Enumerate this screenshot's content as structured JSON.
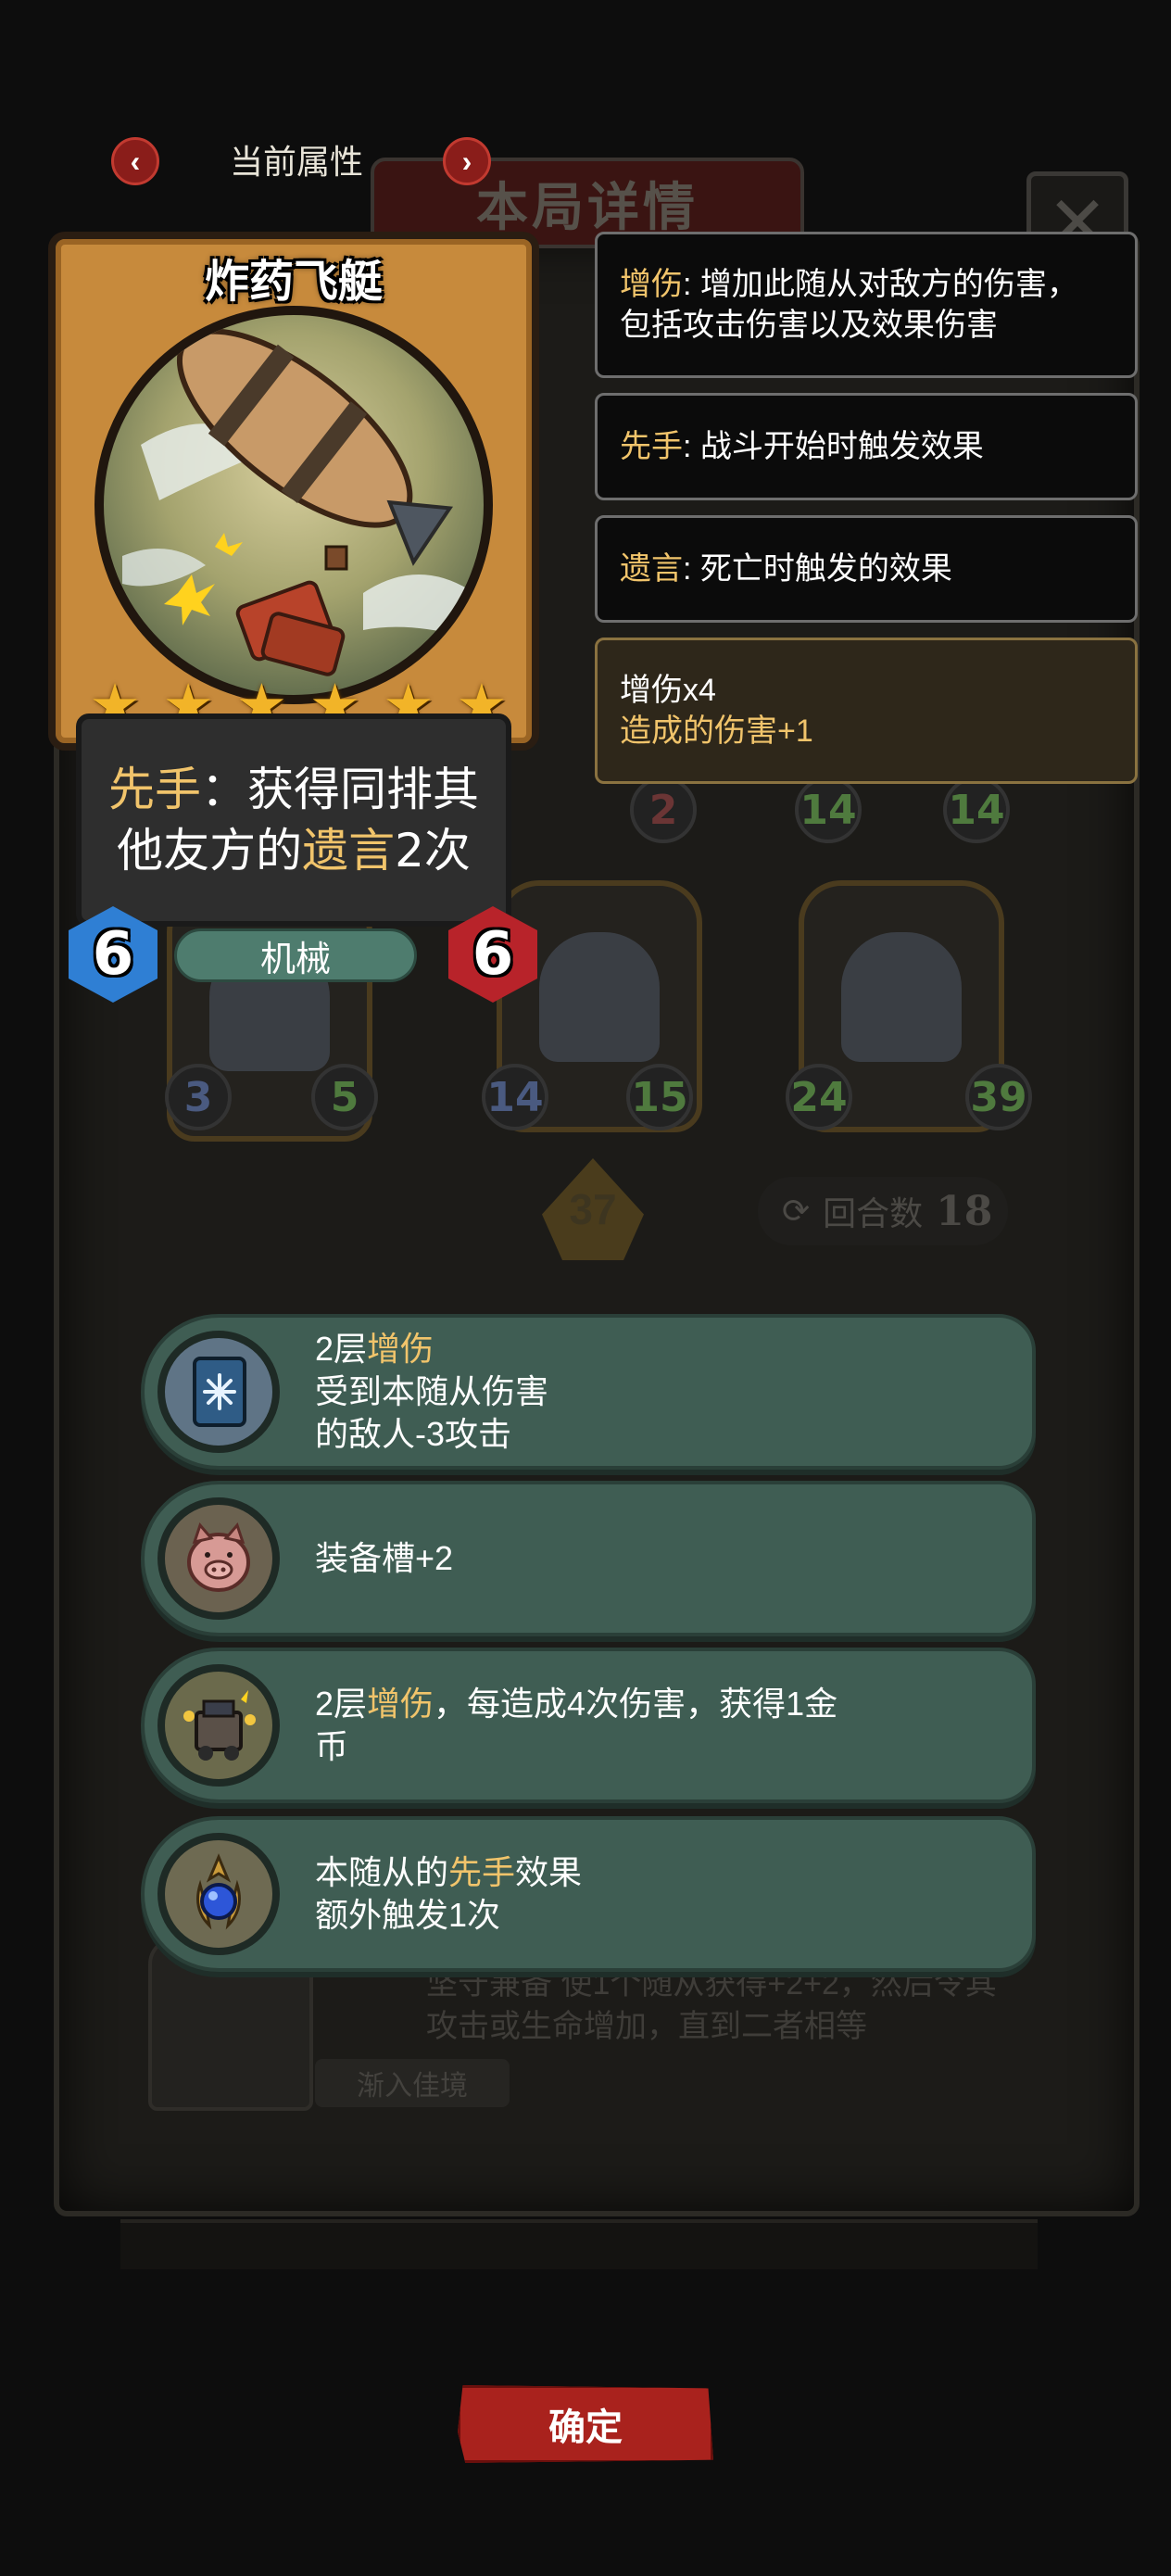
{
  "header": {
    "prev_icon": "chevron-left",
    "next_icon": "chevron-right",
    "title": "当前属性"
  },
  "background": {
    "panel_title": "本局详情",
    "close_icon": "close-x",
    "minions": [
      {
        "attack": "3",
        "health": "5"
      },
      {
        "attack": "14",
        "health": "15"
      },
      {
        "attack": "24",
        "health": "39"
      },
      {
        "attack": "2",
        "health": ""
      },
      {
        "attack": "14",
        "health": "14"
      }
    ],
    "tier": "37",
    "round_label": "回合数",
    "round_value": "18",
    "desc_line1": "坚守兼备 使1个随从获得+2+2，然后令其",
    "desc_line2": "攻击或生命增加，直到二者相等",
    "tag": "渐入佳境"
  },
  "card": {
    "name": "炸药飞艇",
    "stars": 6,
    "text_parts": {
      "kw1": "先手",
      "p1": "：获得同排其他友方的",
      "kw2": "遗言",
      "p2": "2次"
    },
    "attack": "6",
    "health": "6",
    "tribe": "机械",
    "colors": {
      "frame": "#c78a3c",
      "attack": "#2f7fd4",
      "health": "#b8232a",
      "tribe": "#4e7c6e"
    }
  },
  "tooltips": [
    {
      "keyword": "增伤",
      "text": ": 增加此随从对敌方的伤害，",
      "text2": "包括攻击伤害以及效果伤害"
    },
    {
      "keyword": "先手",
      "text": ": 战斗开始时触发效果"
    },
    {
      "keyword": "遗言",
      "text": ": 死亡时触发的效果"
    },
    {
      "line1": "增伤x4",
      "line2": "造成的伤害+1"
    }
  ],
  "equipment": [
    {
      "icon": "frost-book-icon",
      "pre": "2层",
      "kw": "增伤",
      "post": "",
      "line2": "受到本随从伤害",
      "line3": "的敌人-3攻击"
    },
    {
      "icon": "pig-icon",
      "text": "装备槽+2"
    },
    {
      "icon": "cannon-machine-icon",
      "pre": "2层",
      "kw": "增伤",
      "post": "，每造成4次伤害，获得1金",
      "line2": "币"
    },
    {
      "icon": "blue-orb-claw-icon",
      "pre": "本随从的",
      "kw": "先手",
      "post": "效果",
      "line2": "额外触发1次"
    }
  ],
  "confirm_label": "确定",
  "accent": "#f1c46b"
}
